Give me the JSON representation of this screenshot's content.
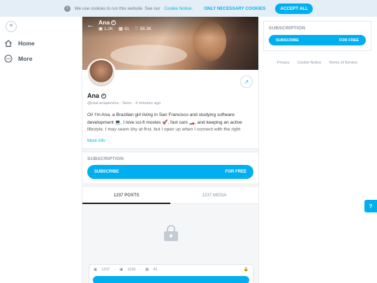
{
  "cookie_bar": {
    "text": "We use cookies to run this website. See our",
    "link": "Cookie Notice.",
    "necessary_label": "ONLY NECESSARY COOKIES",
    "accept_label": "ACCEPT ALL"
  },
  "nav": {
    "items": [
      {
        "label": "Home",
        "icon": "home-icon"
      },
      {
        "label": "More",
        "icon": "more-icon"
      }
    ]
  },
  "profile": {
    "name": "Ana",
    "handle": "@real.anapereira",
    "seen": "Seen · 4 minutes ago",
    "stats": {
      "photos": "1.2K",
      "videos": "41",
      "likes": "58.3K"
    },
    "bio": "Oi! I'm Ana, a Brazilian girl living in San Francisco and studying software development 💻. I love sci-fi movies 🚀, fast cars 🏎️, and keeping an active lifestyle. I may seem shy at first, but I open up when I connect with the right person. If",
    "more_info": "More info"
  },
  "subscription": {
    "title": "SUBSCRIPTION",
    "button_label": "SUBSCRIBE",
    "price": "FOR FREE"
  },
  "tabs": [
    {
      "label": "1237 POSTS",
      "active": true
    },
    {
      "label": "1237 MEDIA",
      "active": false
    }
  ],
  "locked_post": {
    "counts": {
      "media": "1237",
      "photos": "1196",
      "videos": "41"
    }
  },
  "right": {
    "subscription_title": "SUBSCRIPTION",
    "button_label": "SUBSCRIBE",
    "price": "FOR FREE",
    "links": [
      "Privacy",
      "Cookie Notice",
      "Terms of Service"
    ]
  },
  "colors": {
    "accent": "#00aff0",
    "muted": "#8a96a3"
  }
}
